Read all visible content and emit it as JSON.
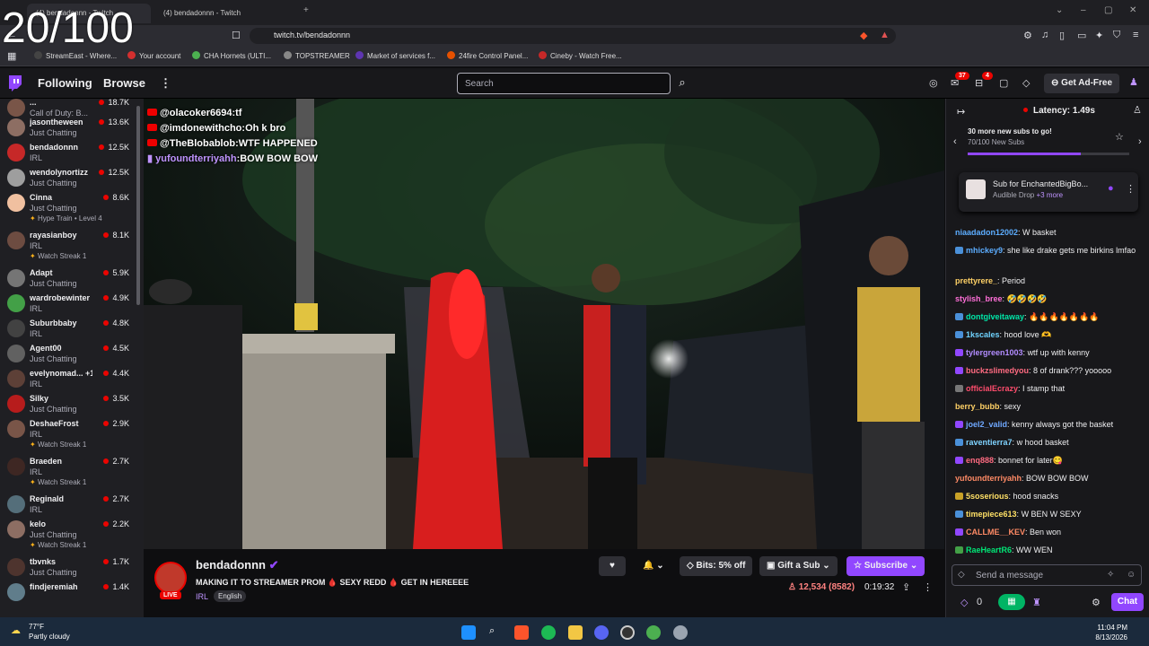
{
  "overlay_counter": "20/100",
  "browser": {
    "tabs": [
      {
        "label": "(4) bendadonnn - Twitch"
      },
      {
        "label": "(4) bendadonnn - Twitch"
      }
    ],
    "url": "twitch.tv/bendadonnn",
    "bookmarks": [
      {
        "label": "StreamEast - Where...",
        "color": "#222"
      },
      {
        "label": "Your account",
        "color": "#d32f2f"
      },
      {
        "label": "CHA Hornets (ULTI...",
        "color": "#4caf50"
      },
      {
        "label": "TOPSTREAMER",
        "color": "#888"
      },
      {
        "label": "Market of services f...",
        "color": "#5e35b1"
      },
      {
        "label": "24fire Control Panel...",
        "color": "#e65100"
      },
      {
        "label": "Cineby - Watch Free...",
        "color": "#c62828"
      }
    ]
  },
  "twitch_nav": {
    "following": "Following",
    "browse": "Browse",
    "search_placeholder": "Search",
    "notif_count": "37",
    "inbox_count": "4",
    "ad_free": "Get Ad-Free"
  },
  "sidebar": {
    "top_partial": {
      "name": "...",
      "category": "Call of Duty: B...",
      "viewers": "18.7K"
    },
    "channels": [
      {
        "name": "jasontheween",
        "category": "Just Chatting",
        "viewers": "13.6K",
        "extra": "",
        "color": "#8d6e63"
      },
      {
        "name": "bendadonnn",
        "category": "IRL",
        "viewers": "12.5K",
        "extra": "",
        "color": "#c62828"
      },
      {
        "name": "wendolynortizz",
        "category": "Just Chatting",
        "viewers": "12.5K",
        "extra": "",
        "color": "#9e9e9e"
      },
      {
        "name": "Cinna",
        "category": "Just Chatting",
        "viewers": "8.6K",
        "extra": "Hype Train • Level 4",
        "color": "#f0c0a0"
      },
      {
        "name": "rayasianboy",
        "category": "IRL",
        "viewers": "8.1K",
        "extra": "Watch Streak 1",
        "color": "#6d4c41"
      },
      {
        "name": "Adapt",
        "category": "Just Chatting",
        "viewers": "5.9K",
        "extra": "",
        "color": "#757575"
      },
      {
        "name": "wardrobewinter",
        "category": "IRL",
        "viewers": "4.9K",
        "extra": "",
        "color": "#43a047"
      },
      {
        "name": "Suburbbaby",
        "category": "IRL",
        "viewers": "4.8K",
        "extra": "",
        "color": "#424242"
      },
      {
        "name": "Agent00",
        "category": "Just Chatting",
        "viewers": "4.5K",
        "extra": "",
        "color": "#616161"
      },
      {
        "name": "evelynomad... +1",
        "category": "IRL",
        "viewers": "4.4K",
        "extra": "",
        "color": "#5d4037"
      },
      {
        "name": "Silky",
        "category": "Just Chatting",
        "viewers": "3.5K",
        "extra": "",
        "color": "#b71c1c"
      },
      {
        "name": "DeshaeFrost",
        "category": "IRL",
        "viewers": "2.9K",
        "extra": "Watch Streak 1",
        "color": "#795548"
      },
      {
        "name": "Braeden",
        "category": "IRL",
        "viewers": "2.7K",
        "extra": "Watch Streak 1",
        "color": "#3e2723"
      },
      {
        "name": "Reginald",
        "category": "IRL",
        "viewers": "2.7K",
        "extra": "",
        "color": "#546e7a"
      },
      {
        "name": "kelo",
        "category": "Just Chatting",
        "viewers": "2.2K",
        "extra": "Watch Streak 1",
        "color": "#8d6e63"
      },
      {
        "name": "tbvnks",
        "category": "Just Chatting",
        "viewers": "1.7K",
        "extra": "",
        "color": "#4e342e"
      },
      {
        "name": "findjeremiah",
        "category": "",
        "viewers": "1.4K",
        "extra": "",
        "color": "#607d8b"
      }
    ]
  },
  "stream_overlay_chat": [
    {
      "user": "@olacoker6694",
      "text": "tf",
      "yt": true
    },
    {
      "user": "@imdonewithcho",
      "text": "Oh k bro",
      "yt": true
    },
    {
      "user": "@TheBlobablob",
      "text": "WTF HAPPENED",
      "yt": true
    },
    {
      "user": "yufoundterriyahh",
      "text": "BOW BOW BOW",
      "yt": false
    }
  ],
  "stream_info": {
    "streamer": "bendadonnn",
    "live": "LIVE",
    "title": "MAKING IT TO STREAMER PROM 🩸 SEXY REDD 🩸 GET IN HEREEEE",
    "category": "IRL",
    "language": "English",
    "bits": "Bits: 5% off",
    "gift": "Gift a Sub",
    "subscribe": "Subscribe",
    "viewers": "12,534 (8582)",
    "uptime": "0:19:32"
  },
  "chat": {
    "latency": "Latency: 1.49s",
    "goal_title": "30 more new subs to go!",
    "goal_progress_text": "70/100 New Subs",
    "goal_fraction": 0.7,
    "drop_title": "Sub for EnchantedBigBo...",
    "drop_sub": "Audible Drop",
    "drop_more": "+3 more",
    "messages": [
      {
        "user": "niaadadon12002",
        "text": "W basket",
        "color": "#5cadff",
        "badge": ""
      },
      {
        "user": "mhickey9",
        "text": "she like drake gets me birkins lmfao",
        "color": "#5cadff",
        "badge": "#4a90d9"
      },
      {
        "user": "prettyrere_",
        "text": "Period",
        "color": "#ffd166",
        "badge": ""
      },
      {
        "user": "stylish_bree",
        "text": "🤣🤣🤣🤣",
        "color": "#ff6fd8",
        "badge": ""
      },
      {
        "user": "dontgiveitaway",
        "text": "🔥🔥🔥🔥🔥🔥🔥",
        "color": "#00e6a8",
        "badge": "#4a90d9"
      },
      {
        "user": "1kscales",
        "text": "hood love 🫶",
        "color": "#6fd3ff",
        "badge": "#4a90d9"
      },
      {
        "user": "tylergreen1003",
        "text": "wtf up with kenny",
        "color": "#b28cff",
        "badge": "#9147ff"
      },
      {
        "user": "buckzslimedyou",
        "text": "8 of drank??? yooooo",
        "color": "#ff6b81",
        "badge": "#9147ff"
      },
      {
        "user": "officialEcrazy",
        "text": "I stamp that",
        "color": "#ff4d6d",
        "badge": "#777"
      },
      {
        "user": "berry_bubb",
        "text": "sexy",
        "color": "#ffd166",
        "badge": ""
      },
      {
        "user": "joel2_valid",
        "text": "kenny always got the basket",
        "color": "#6fa8ff",
        "badge": "#9147ff"
      },
      {
        "user": "raventierra7",
        "text": "w hood basket",
        "color": "#7fd3ff",
        "badge": "#4a90d9"
      },
      {
        "user": "enq888",
        "text": "bonnet for later😋",
        "color": "#ff6b81",
        "badge": "#9147ff"
      },
      {
        "user": "yufoundterriyahh",
        "text": "BOW BOW BOW",
        "color": "#ff8a65",
        "badge": ""
      },
      {
        "user": "5soserious",
        "text": "hood snacks",
        "color": "#ffe066",
        "badge": "#c9a227"
      },
      {
        "user": "timepiece613",
        "text": "W BEN W SEXY",
        "color": "#ffe066",
        "badge": "#4a90d9"
      },
      {
        "user": "CALLME__KEV",
        "text": "Ben won",
        "color": "#ff8a65",
        "badge": "#9147ff"
      },
      {
        "user": "RaeHeartR6",
        "text": "WW WEN",
        "color": "#00e676",
        "badge": "#43a047"
      }
    ],
    "input_placeholder": "Send a message",
    "points": "0",
    "chat_button": "Chat"
  },
  "taskbar": {
    "temp": "77°F",
    "weather": "Partly cloudy",
    "time": "11:04 PM",
    "date": "8/13/2026"
  }
}
